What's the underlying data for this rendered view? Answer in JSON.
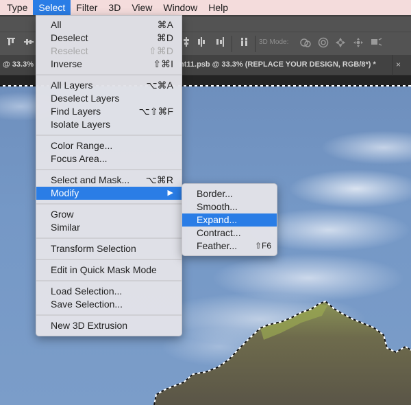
{
  "menubar": {
    "items": [
      {
        "label": "Type"
      },
      {
        "label": "Select",
        "active": true
      },
      {
        "label": "Filter"
      },
      {
        "label": "3D"
      },
      {
        "label": "View"
      },
      {
        "label": "Window"
      },
      {
        "label": "Help"
      }
    ]
  },
  "options_bar": {
    "mode_label": "3D Mode:",
    "icons": [
      "align-top-icon",
      "align-vcenter-icon",
      "align-bottom-icon",
      "distribute-icon",
      "distribute-h-icon",
      "orbit-3d-icon",
      "roll-3d-icon",
      "pan-3d-icon",
      "slide-3d-icon",
      "camera-3d-icon"
    ]
  },
  "tabs": {
    "left_tab_fragment": "@ 33.3%",
    "active_tab": "nt11.psb @ 33.3% (REPLACE YOUR DESIGN, RGB/8*) *",
    "close_symbol": "×"
  },
  "select_menu": {
    "groups": [
      [
        {
          "label": "All",
          "shortcut": "⌘A"
        },
        {
          "label": "Deselect",
          "shortcut": "⌘D"
        },
        {
          "label": "Reselect",
          "shortcut": "⇧⌘D",
          "disabled": true
        },
        {
          "label": "Inverse",
          "shortcut": "⇧⌘I"
        }
      ],
      [
        {
          "label": "All Layers",
          "shortcut": "⌥⌘A"
        },
        {
          "label": "Deselect Layers",
          "shortcut": ""
        },
        {
          "label": "Find Layers",
          "shortcut": "⌥⇧⌘F"
        },
        {
          "label": "Isolate Layers",
          "shortcut": ""
        }
      ],
      [
        {
          "label": "Color Range...",
          "shortcut": ""
        },
        {
          "label": "Focus Area...",
          "shortcut": ""
        }
      ],
      [
        {
          "label": "Select and Mask...",
          "shortcut": "⌥⌘R"
        },
        {
          "label": "Modify",
          "submenu_arrow": "▶",
          "highlighted": true
        }
      ],
      [
        {
          "label": "Grow",
          "shortcut": ""
        },
        {
          "label": "Similar",
          "shortcut": ""
        }
      ],
      [
        {
          "label": "Transform Selection",
          "shortcut": ""
        }
      ],
      [
        {
          "label": "Edit in Quick Mask Mode",
          "shortcut": ""
        }
      ],
      [
        {
          "label": "Load Selection...",
          "shortcut": ""
        },
        {
          "label": "Save Selection...",
          "shortcut": ""
        }
      ],
      [
        {
          "label": "New 3D Extrusion",
          "shortcut": ""
        }
      ]
    ]
  },
  "modify_menu": {
    "items": [
      {
        "label": "Border...",
        "shortcut": ""
      },
      {
        "label": "Smooth...",
        "shortcut": ""
      },
      {
        "label": "Expand...",
        "shortcut": "",
        "highlighted": true
      },
      {
        "label": "Contract...",
        "shortcut": ""
      },
      {
        "label": "Feather...",
        "shortcut": "⇧F6"
      }
    ]
  },
  "colors": {
    "highlight": "#2a7de6",
    "menubar_bg": "#f4dcdc",
    "panel_bg": "#535353"
  }
}
